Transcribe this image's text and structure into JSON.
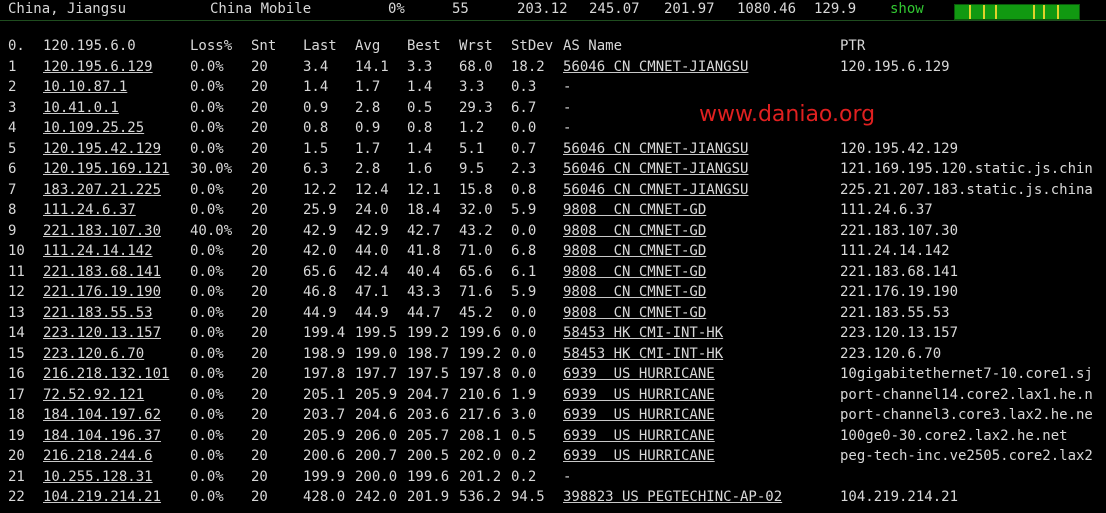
{
  "status_bar": {
    "location": "China, Jiangsu",
    "isp": "China Mobile",
    "loss": "0%",
    "snt": "55",
    "last": "203.12",
    "avg": "245.07",
    "best": "201.97",
    "wrst": "1080.46",
    "stdev": "129.9",
    "show_label": "show"
  },
  "table": {
    "headers": {
      "num": "0.",
      "host": "120.195.6.0",
      "loss": "Loss%",
      "snt": "Snt",
      "last": "Last",
      "avg": "Avg",
      "best": "Best",
      "wrst": "Wrst",
      "stdev": "StDev",
      "as": "AS Name",
      "ptr": "PTR"
    },
    "rows": [
      {
        "num": "1",
        "host": "120.195.6.129",
        "loss": "0.0%",
        "snt": "20",
        "last": "3.4",
        "avg": "14.1",
        "best": "3.3",
        "wrst": "68.0",
        "stdev": "18.2",
        "as": "56046 CN CMNET-JIANGSU",
        "ptr": "120.195.6.129"
      },
      {
        "num": "2",
        "host": "10.10.87.1",
        "loss": "0.0%",
        "snt": "20",
        "last": "1.4",
        "avg": "1.7",
        "best": "1.4",
        "wrst": "3.3",
        "stdev": "0.3",
        "as": "-",
        "ptr": ""
      },
      {
        "num": "3",
        "host": "10.41.0.1",
        "loss": "0.0%",
        "snt": "20",
        "last": "0.9",
        "avg": "2.8",
        "best": "0.5",
        "wrst": "29.3",
        "stdev": "6.7",
        "as": "-",
        "ptr": ""
      },
      {
        "num": "4",
        "host": "10.109.25.25",
        "loss": "0.0%",
        "snt": "20",
        "last": "0.8",
        "avg": "0.9",
        "best": "0.8",
        "wrst": "1.2",
        "stdev": "0.0",
        "as": "-",
        "ptr": ""
      },
      {
        "num": "5",
        "host": "120.195.42.129",
        "loss": "0.0%",
        "snt": "20",
        "last": "1.5",
        "avg": "1.7",
        "best": "1.4",
        "wrst": "5.1",
        "stdev": "0.7",
        "as": "56046 CN CMNET-JIANGSU",
        "ptr": "120.195.42.129"
      },
      {
        "num": "6",
        "host": "120.195.169.121",
        "loss": "30.0%",
        "snt": "20",
        "last": "6.3",
        "avg": "2.8",
        "best": "1.6",
        "wrst": "9.5",
        "stdev": "2.3",
        "as": "56046 CN CMNET-JIANGSU",
        "ptr": "121.169.195.120.static.js.chin"
      },
      {
        "num": "7",
        "host": "183.207.21.225",
        "loss": "0.0%",
        "snt": "20",
        "last": "12.2",
        "avg": "12.4",
        "best": "12.1",
        "wrst": "15.8",
        "stdev": "0.8",
        "as": "56046 CN CMNET-JIANGSU",
        "ptr": "225.21.207.183.static.js.china"
      },
      {
        "num": "8",
        "host": "111.24.6.37",
        "loss": "0.0%",
        "snt": "20",
        "last": "25.9",
        "avg": "24.0",
        "best": "18.4",
        "wrst": "32.0",
        "stdev": "5.9",
        "as": "9808  CN CMNET-GD",
        "ptr": "111.24.6.37"
      },
      {
        "num": "9",
        "host": "221.183.107.30",
        "loss": "40.0%",
        "snt": "20",
        "last": "42.9",
        "avg": "42.9",
        "best": "42.7",
        "wrst": "43.2",
        "stdev": "0.0",
        "as": "9808  CN CMNET-GD",
        "ptr": "221.183.107.30"
      },
      {
        "num": "10",
        "host": "111.24.14.142",
        "loss": "0.0%",
        "snt": "20",
        "last": "42.0",
        "avg": "44.0",
        "best": "41.8",
        "wrst": "71.0",
        "stdev": "6.8",
        "as": "9808  CN CMNET-GD",
        "ptr": "111.24.14.142"
      },
      {
        "num": "11",
        "host": "221.183.68.141",
        "loss": "0.0%",
        "snt": "20",
        "last": "65.6",
        "avg": "42.4",
        "best": "40.4",
        "wrst": "65.6",
        "stdev": "6.1",
        "as": "9808  CN CMNET-GD",
        "ptr": "221.183.68.141"
      },
      {
        "num": "12",
        "host": "221.176.19.190",
        "loss": "0.0%",
        "snt": "20",
        "last": "46.8",
        "avg": "47.1",
        "best": "43.3",
        "wrst": "71.6",
        "stdev": "5.9",
        "as": "9808  CN CMNET-GD",
        "ptr": "221.176.19.190"
      },
      {
        "num": "13",
        "host": "221.183.55.53",
        "loss": "0.0%",
        "snt": "20",
        "last": "44.9",
        "avg": "44.9",
        "best": "44.7",
        "wrst": "45.2",
        "stdev": "0.0",
        "as": "9808  CN CMNET-GD",
        "ptr": "221.183.55.53"
      },
      {
        "num": "14",
        "host": "223.120.13.157",
        "loss": "0.0%",
        "snt": "20",
        "last": "199.4",
        "avg": "199.5",
        "best": "199.2",
        "wrst": "199.6",
        "stdev": "0.0",
        "as": "58453 HK CMI-INT-HK",
        "ptr": "223.120.13.157"
      },
      {
        "num": "15",
        "host": "223.120.6.70",
        "loss": "0.0%",
        "snt": "20",
        "last": "198.9",
        "avg": "199.0",
        "best": "198.7",
        "wrst": "199.2",
        "stdev": "0.0",
        "as": "58453 HK CMI-INT-HK",
        "ptr": "223.120.6.70"
      },
      {
        "num": "16",
        "host": "216.218.132.101",
        "loss": "0.0%",
        "snt": "20",
        "last": "197.8",
        "avg": "197.7",
        "best": "197.5",
        "wrst": "197.8",
        "stdev": "0.0",
        "as": "6939  US HURRICANE",
        "ptr": "10gigabitethernet7-10.core1.sj"
      },
      {
        "num": "17",
        "host": "72.52.92.121",
        "loss": "0.0%",
        "snt": "20",
        "last": "205.1",
        "avg": "205.9",
        "best": "204.7",
        "wrst": "210.6",
        "stdev": "1.9",
        "as": "6939  US HURRICANE",
        "ptr": "port-channel14.core2.lax1.he.n"
      },
      {
        "num": "18",
        "host": "184.104.197.62",
        "loss": "0.0%",
        "snt": "20",
        "last": "203.7",
        "avg": "204.6",
        "best": "203.6",
        "wrst": "217.6",
        "stdev": "3.0",
        "as": "6939  US HURRICANE",
        "ptr": "port-channel3.core3.lax2.he.ne"
      },
      {
        "num": "19",
        "host": "184.104.196.37",
        "loss": "0.0%",
        "snt": "20",
        "last": "205.9",
        "avg": "206.0",
        "best": "205.7",
        "wrst": "208.1",
        "stdev": "0.5",
        "as": "6939  US HURRICANE",
        "ptr": "100ge0-30.core2.lax2.he.net"
      },
      {
        "num": "20",
        "host": "216.218.244.6",
        "loss": "0.0%",
        "snt": "20",
        "last": "200.6",
        "avg": "200.7",
        "best": "200.5",
        "wrst": "202.0",
        "stdev": "0.2",
        "as": "6939  US HURRICANE",
        "ptr": "peg-tech-inc.ve2505.core2.lax2"
      },
      {
        "num": "21",
        "host": "10.255.128.31",
        "loss": "0.0%",
        "snt": "20",
        "last": "199.9",
        "avg": "200.0",
        "best": "199.6",
        "wrst": "201.2",
        "stdev": "0.2",
        "as": "-",
        "ptr": ""
      },
      {
        "num": "22",
        "host": "104.219.214.21",
        "loss": "0.0%",
        "snt": "20",
        "last": "428.0",
        "avg": "242.0",
        "best": "201.9",
        "wrst": "536.2",
        "stdev": "94.5",
        "as": "398823 US PEGTECHINC-AP-02",
        "ptr": "104.219.214.21"
      }
    ]
  },
  "watermark": "www.daniao.org",
  "colors": {
    "background": "#000000",
    "text": "#d8d8d8",
    "show_link": "#32c832",
    "sparkline_fill": "#119911",
    "sparkline_tick": "#e0d22a",
    "watermark": "#e02020"
  }
}
